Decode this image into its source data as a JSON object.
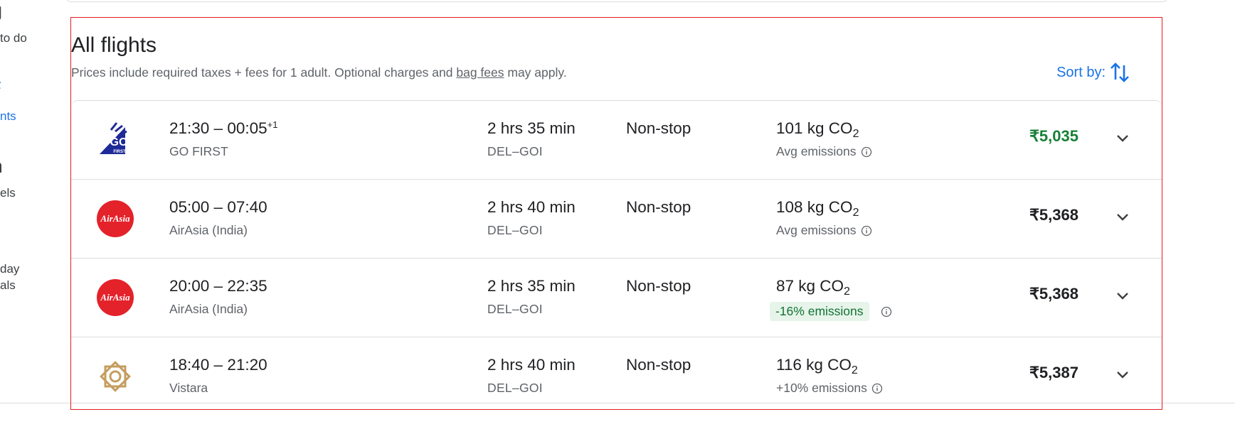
{
  "rail": {
    "items": [
      {
        "label": "to do",
        "active": false
      },
      {
        "label": "nts",
        "active": true
      },
      {
        "label": "els",
        "active": false
      },
      {
        "label": "day\nals",
        "active": false
      }
    ]
  },
  "section": {
    "title": "All flights",
    "subtitle_prefix": "Prices include required taxes + fees for 1 adult. Optional charges and ",
    "subtitle_link": "bag fees",
    "subtitle_suffix": " may apply.",
    "sort_label": "Sort by:"
  },
  "flights": [
    {
      "times": "21:30 – 00:05",
      "day_offset": "+1",
      "airline": "GO FIRST",
      "duration": "2 hrs 35 min",
      "route": "DEL–GOI",
      "stops": "Non-stop",
      "co2_value": "101 kg CO",
      "co2_sub": "2",
      "emissions": "Avg emissions",
      "price": "₹5,035",
      "logo": "gofirst-logo"
    },
    {
      "times": "05:00 – 07:40",
      "day_offset": "",
      "airline": "AirAsia (India)",
      "duration": "2 hrs 40 min",
      "route": "DEL–GOI",
      "stops": "Non-stop",
      "co2_value": "108 kg CO",
      "co2_sub": "2",
      "emissions": "Avg emissions",
      "price": "₹5,368",
      "logo": "airasia-logo"
    },
    {
      "times": "20:00 – 22:35",
      "day_offset": "",
      "airline": "AirAsia (India)",
      "duration": "2 hrs 35 min",
      "route": "DEL–GOI",
      "stops": "Non-stop",
      "co2_value": "87 kg CO",
      "co2_sub": "2",
      "emissions": "-16% emissions",
      "price": "₹5,368",
      "logo": "airasia-logo"
    },
    {
      "times": "18:40 – 21:20",
      "day_offset": "",
      "airline": "Vistara",
      "duration": "2 hrs 40 min",
      "route": "DEL–GOI",
      "stops": "Non-stop",
      "co2_value": "116 kg CO",
      "co2_sub": "2",
      "emissions": "+10% emissions",
      "price": "₹5,387",
      "logo": "vistara-logo"
    }
  ],
  "logo_texts": {
    "gofirst_main": "GO",
    "gofirst_sub": "FIRST",
    "airasia": "AirAsia"
  },
  "colors": {
    "accent_blue": "#1a73e8",
    "best_price_green": "#188038",
    "emission_badge_bg": "#e6f4ea",
    "highlight_red": "#e51c23",
    "airasia_red": "#e3222a",
    "gofirst_blue": "#1e2a97",
    "vistara_gold": "#c59d5f"
  }
}
